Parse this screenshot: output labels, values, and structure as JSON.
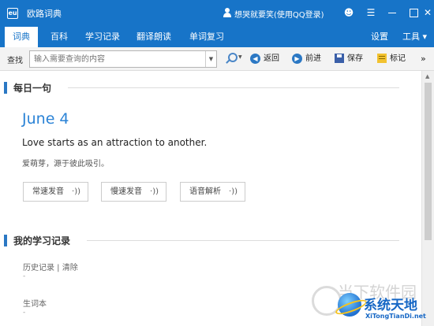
{
  "window": {
    "title": "欧路词典",
    "logo_text": "eu",
    "user": "想哭就要笑(使用QQ登录)"
  },
  "tabs": {
    "dict": "词典",
    "baike": "百科",
    "record": "学习记录",
    "translate": "翻译朗读",
    "review": "单词复习",
    "settings": "设置",
    "tools": "工具 ▾"
  },
  "search": {
    "label": "查找",
    "placeholder": "输入需要查询的内容",
    "back": "返回",
    "forward": "前进",
    "save": "保存",
    "mark": "标记",
    "more": "»"
  },
  "daily": {
    "heading": "每日一句",
    "date": "June 4",
    "sentence_en": "Love starts as an attraction to another.",
    "sentence_cn": "爱萌芽，源于彼此吸引。",
    "btn_normal": "常速发音",
    "btn_slow": "慢速发音",
    "btn_analysis": "语音解析",
    "sound_glyph": "·))"
  },
  "records": {
    "heading": "我的学习记录",
    "history": "历史记录 | 清除",
    "history_value": "-",
    "wordbook": "生词本",
    "wordbook_value": "-"
  },
  "watermark": {
    "faded": "当下软件园",
    "brand": "系统天地",
    "url": "XiTongTianDi.net"
  },
  "colors": {
    "accent": "#1774c8",
    "date_blue": "#2b83d6"
  }
}
